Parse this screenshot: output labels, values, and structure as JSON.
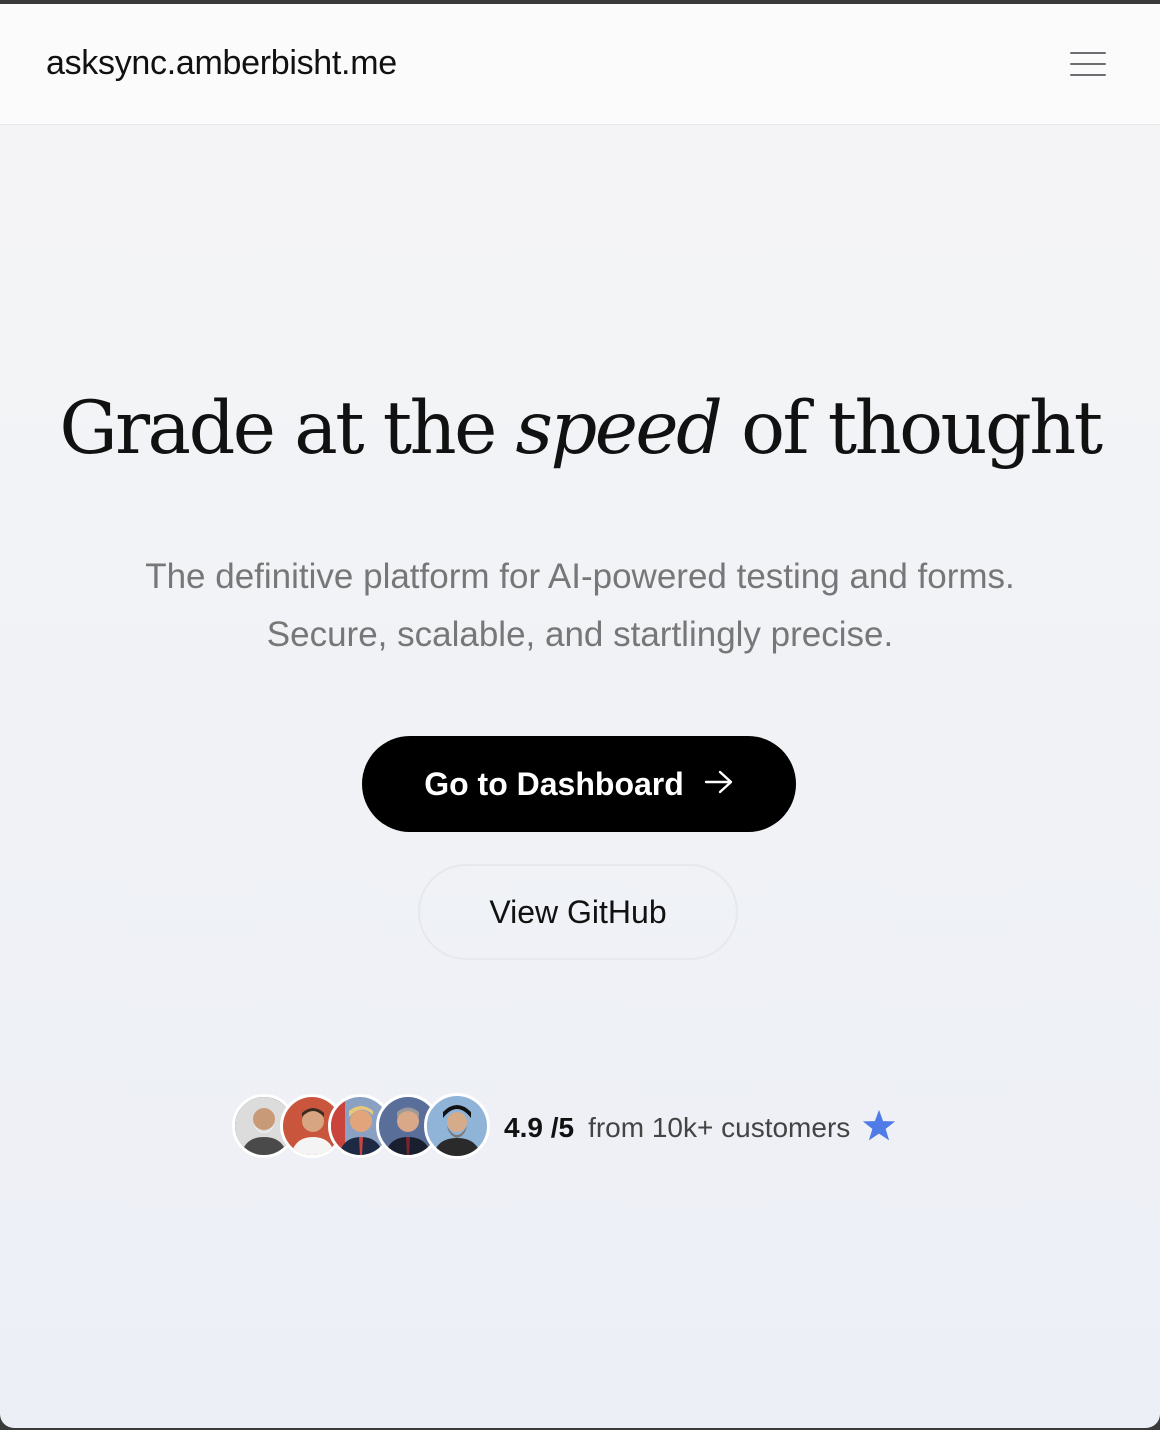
{
  "nav": {
    "brand": "asksync.amberbisht.me",
    "menu_icon": "hamburger-menu-icon"
  },
  "hero": {
    "title_before": "Grade at the ",
    "title_emphasis": "speed",
    "title_after": " of thought",
    "subtitle_line1": "The definitive platform for AI-powered testing and forms.",
    "subtitle_line2": "Secure, scalable, and startlingly precise."
  },
  "actions": {
    "primary_label": "Go to Dashboard",
    "primary_icon": "arrow-right-icon",
    "secondary_label": "View GitHub"
  },
  "social_proof": {
    "rating": "4.9 /5",
    "text": "from 10k+ customers",
    "star_icon": "star-icon",
    "star_color": "#4f7be6",
    "avatar_count": 5
  },
  "colors": {
    "primary_button_bg": "#000000",
    "page_bg": "#f3f4f7"
  }
}
